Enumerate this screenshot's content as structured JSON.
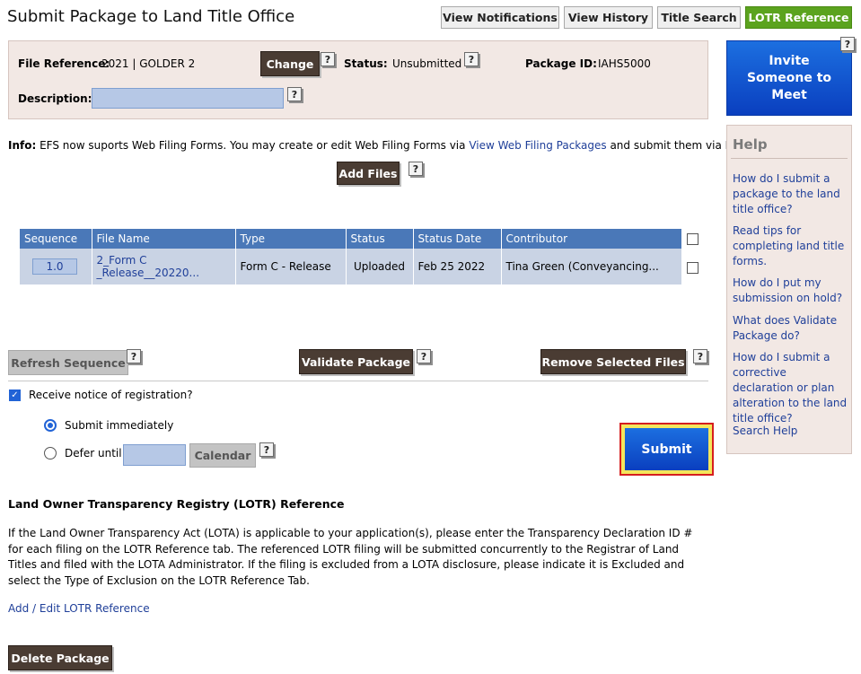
{
  "page": {
    "title": "Submit Package to Land Title Office"
  },
  "tabs": [
    {
      "label": "View Notifications"
    },
    {
      "label": "View History"
    },
    {
      "label": "Title Search"
    },
    {
      "label": "LOTR Reference"
    }
  ],
  "package": {
    "file_reference_label": "File Reference:",
    "file_reference_value": "2021 | GOLDER 2",
    "change_label": "Change",
    "status_label": "Status:",
    "status_value": "Unsubmitted",
    "package_id_label": "Package ID:",
    "package_id_value": "IAHS5000",
    "description_label": "Description:",
    "description_value": ""
  },
  "help_q": "?",
  "info": {
    "label": "Info:",
    "text_before": " EFS now suports Web Filing Forms. You may create or edit Web Filing Forms via ",
    "link": "View Web Filing Packages",
    "text_after": " and submit them via EFS."
  },
  "add_files_label": "Add Files",
  "table": {
    "headers": [
      "Sequence",
      "File Name",
      "Type",
      "Status",
      "Status Date",
      "Contributor"
    ],
    "rows": [
      {
        "sequence": "1.0",
        "file_name_line1": "2_Form C",
        "file_name_line2": "_Release__20220...",
        "type": "Form C - Release",
        "status": "Uploaded",
        "status_date": "Feb 25 2022",
        "contributor": "Tina Green (Conveyancing..."
      }
    ]
  },
  "actions": {
    "refresh": "Refresh Sequence",
    "validate": "Validate Package",
    "remove": "Remove Selected Files"
  },
  "registration": {
    "notice_label": "Receive notice of registration?",
    "notice_checked": true,
    "submit_immediately": "Submit immediately",
    "defer_until": "Defer until",
    "calendar": "Calendar",
    "submit": "Submit"
  },
  "lotr": {
    "title": "Land Owner Transparency Registry (LOTR) Reference",
    "paragraph": "If the Land Owner Transparency Act (LOTA) is applicable to your application(s), please enter the Transparency Declaration ID # for each filing on the LOTR Reference tab. The referenced LOTR filing will be submitted concurrently to the Registrar of Land Titles and filed with the LOTA Administrator. If the filing is excluded from a LOTA disclosure, please indicate it is Excluded and select the Type of Exclusion on the LOTR Reference Tab.",
    "link": "Add / Edit LOTR Reference"
  },
  "delete_label": "Delete Package",
  "sidebar": {
    "invite_line1": "Invite",
    "invite_line2": "Someone to",
    "invite_line3": "Meet",
    "help_title": "Help",
    "help_links": [
      "How do I submit a package to the land title office?",
      "Read tips for completing land title forms.",
      "How do I put my submission on hold?",
      "What does Validate Package do?",
      "How do I submit a corrective declaration or plan alteration to the land title office?",
      "Search Help"
    ]
  },
  "colors": {
    "accent_blue": "#1c6fe0",
    "tab_active": "#5ba31e",
    "dark_button": "#4a3c33",
    "panel_bg": "#f2e8e4",
    "table_header": "#4a78b8",
    "table_row": "#c9d3e4",
    "link": "#1f3f99"
  }
}
